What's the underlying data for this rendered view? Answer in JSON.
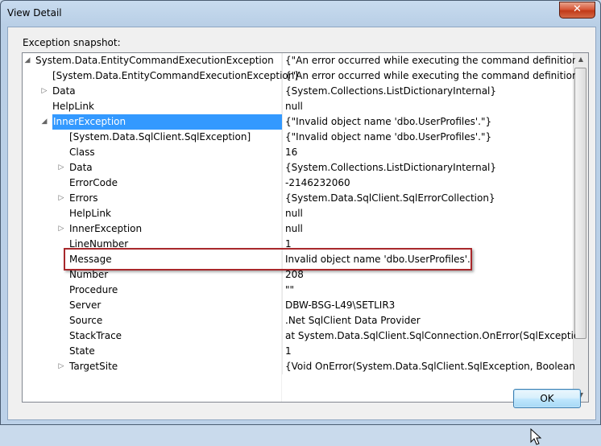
{
  "window": {
    "title": "View Detail",
    "close_glyph": "✕"
  },
  "snapshot_label": "Exception snapshot:",
  "rows": [
    {
      "name": "System.Data.EntityCommandExecutionException",
      "value": "{\"An error occurred while executing the command definition. Se",
      "expander": "expanded"
    },
    {
      "name": "[System.Data.EntityCommandExecutionException]",
      "value": "{\"An error occurred while executing the command definition. Se",
      "expander": "none"
    },
    {
      "name": "Data",
      "value": "{System.Collections.ListDictionaryInternal}",
      "expander": "collapsed"
    },
    {
      "name": "HelpLink",
      "value": "null",
      "expander": "none"
    },
    {
      "name": "InnerException",
      "value": "{\"Invalid object name 'dbo.UserProfiles'.\"}",
      "expander": "expanded",
      "selected": true
    },
    {
      "name": "[System.Data.SqlClient.SqlException]",
      "value": "{\"Invalid object name 'dbo.UserProfiles'.\"}",
      "expander": "none"
    },
    {
      "name": "Class",
      "value": "16",
      "expander": "none"
    },
    {
      "name": "Data",
      "value": "{System.Collections.ListDictionaryInternal}",
      "expander": "collapsed"
    },
    {
      "name": "ErrorCode",
      "value": "-2146232060",
      "expander": "none"
    },
    {
      "name": "Errors",
      "value": "{System.Data.SqlClient.SqlErrorCollection}",
      "expander": "collapsed"
    },
    {
      "name": "HelpLink",
      "value": "null",
      "expander": "none"
    },
    {
      "name": "InnerException",
      "value": "null",
      "expander": "collapsed"
    },
    {
      "name": "LineNumber",
      "value": "1",
      "expander": "none"
    },
    {
      "name": "Message",
      "value": "Invalid object name 'dbo.UserProfiles'.",
      "expander": "none",
      "highlighted": true
    },
    {
      "name": "Number",
      "value": "208",
      "expander": "none"
    },
    {
      "name": "Procedure",
      "value": "\"\"",
      "expander": "none"
    },
    {
      "name": "Server",
      "value": "DBW-BSG-L49\\SETLIR3",
      "expander": "none"
    },
    {
      "name": "Source",
      "value": ".Net SqlClient Data Provider",
      "expander": "none"
    },
    {
      "name": "StackTrace",
      "value": "   at System.Data.SqlClient.SqlConnection.OnError(SqlException e",
      "expander": "none"
    },
    {
      "name": "State",
      "value": "1",
      "expander": "none"
    },
    {
      "name": "TargetSite",
      "value": "{Void OnError(System.Data.SqlClient.SqlException, Boolean)}",
      "expander": "collapsed"
    }
  ],
  "ok_label": "OK",
  "colors": {
    "selection": "#3399ff",
    "callout": "#a8282b",
    "title_bar": "#b9cfe6"
  }
}
